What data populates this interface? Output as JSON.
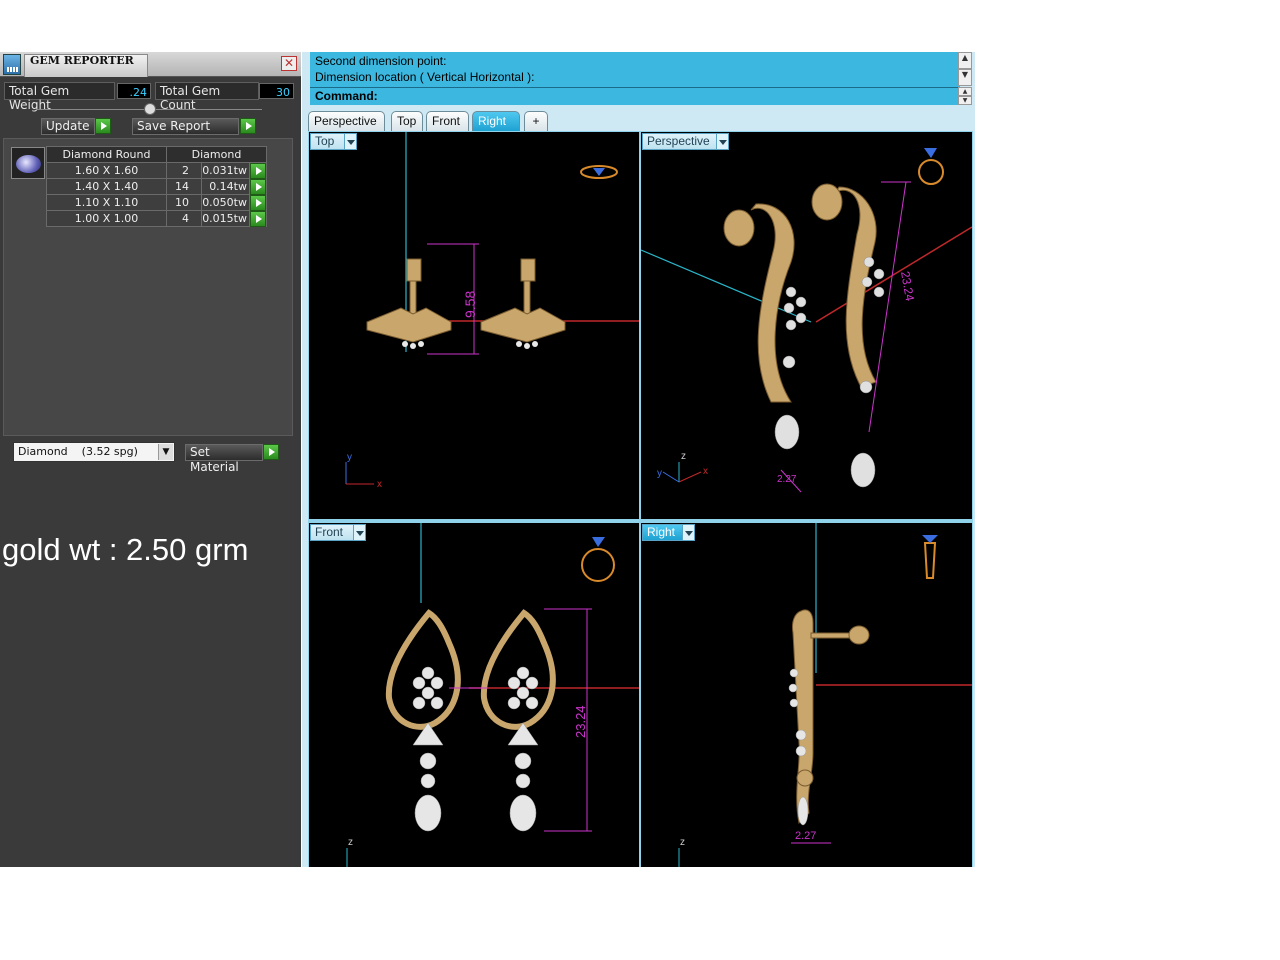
{
  "gem_reporter": {
    "title": "GEM REPORTER",
    "close_glyph": "✕",
    "total_gem_weight_label": "Total Gem Weight",
    "total_gem_weight_value": ".24",
    "total_gem_count_label": "Total Gem Count",
    "total_gem_count_value": "30",
    "update_label": "Update",
    "save_report_label": "Save Report",
    "table": {
      "headers": [
        "Diamond Round",
        "Diamond"
      ],
      "rows": [
        {
          "size": "1.60 X 1.60",
          "count": "2",
          "weight": "0.031tw"
        },
        {
          "size": "1.40 X 1.40",
          "count": "14",
          "weight": "0.14tw"
        },
        {
          "size": "1.10 X 1.10",
          "count": "10",
          "weight": "0.050tw"
        },
        {
          "size": "1.00 X 1.00",
          "count": "4",
          "weight": "0.015tw"
        }
      ]
    },
    "material_value": "Diamond    (3.52 spg)",
    "set_material_label": "Set Material"
  },
  "note": "gold wt : 2.50 grm",
  "command_area": {
    "line1": "Second dimension point:",
    "line2": "Dimension location ( Vertical  Horizontal ):",
    "command_label": "Command:"
  },
  "view_tabs": [
    {
      "label": "Perspective",
      "active": false
    },
    {
      "label": "Top",
      "active": false
    },
    {
      "label": "Front",
      "active": false
    },
    {
      "label": "Right",
      "active": true
    },
    {
      "label": "+",
      "active": false
    }
  ],
  "viewports": {
    "top_left": {
      "label": "Top",
      "dimension": "9.58",
      "axis_y": "y",
      "axis_x": "x"
    },
    "top_right": {
      "label": "Perspective",
      "dimension": "23.24",
      "dimension_small": "2.27",
      "axis_z": "z",
      "axis_y": "y",
      "axis_x": "x"
    },
    "bottom_left": {
      "label": "Front",
      "dimension": "23.24",
      "axis_z": "z"
    },
    "bottom_right": {
      "label": "Right",
      "dimension": "2.27",
      "axis_z": "z"
    }
  },
  "colors": {
    "panel_bg": "#3a3a3a",
    "command_bg": "#3cb8e0",
    "viewport_bg": "#000000",
    "gold": "#c9a66b",
    "dimension": "#cc33cc",
    "axis_red": "#c0282a",
    "axis_cyan": "#2ab5c9"
  }
}
